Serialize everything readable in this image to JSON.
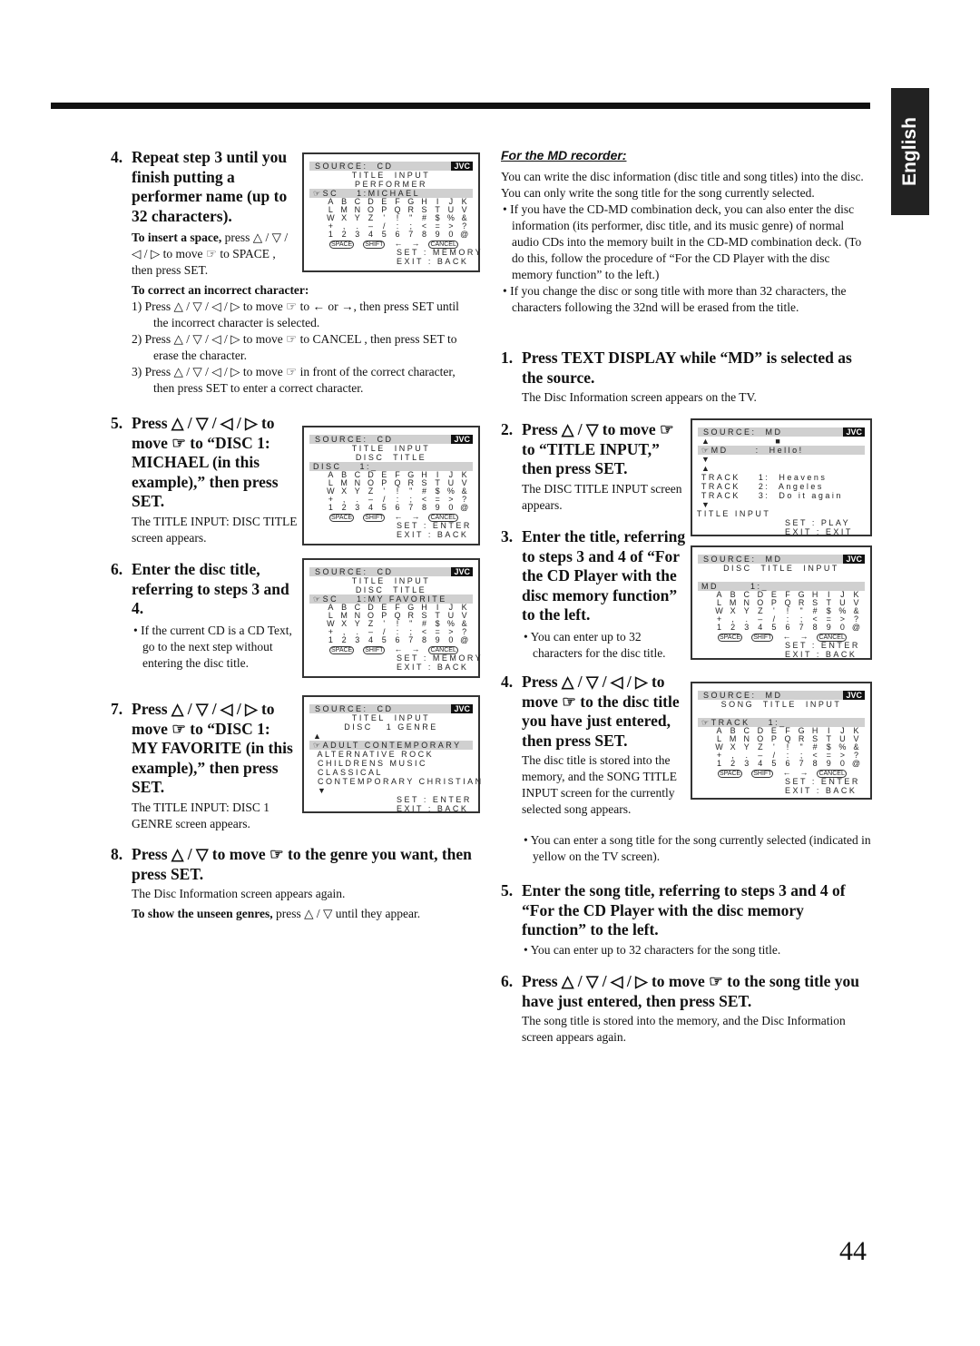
{
  "tab_label": "English",
  "page_number": "44",
  "left": {
    "step4": {
      "num": "4.",
      "title": "Repeat step 3 until you finish putting a performer name (up to 32 characters).",
      "insert_bold": "To insert a space,",
      "insert_text": " press △ / ▽ / ◁ / ▷ to move ☞ to SPACE , then press SET.",
      "correct_heading": "To correct an incorrect character:",
      "correct_items": [
        "1)  Press △ / ▽ / ◁ / ▷ to move ☞ to ← or →, then press SET until the incorrect character is selected.",
        "2)  Press △ / ▽ / ◁ / ▷ to move ☞ to CANCEL , then press SET to erase the character.",
        "3)  Press △ / ▽ / ◁ / ▷ to move ☞ in front of the correct character, then press SET to enter a correct character."
      ]
    },
    "step5": {
      "num": "5.",
      "title": "Press △ / ▽ / ◁ / ▷ to move ☞ to “DISC 1: MICHAEL (in this example),” then press SET.",
      "text": "The TITLE INPUT: DISC TITLE screen appears."
    },
    "step6": {
      "num": "6.",
      "title": "Enter the disc title, referring to steps 3 and 4.",
      "bullet": "If the current CD is a CD Text, go to the next step without entering the disc title."
    },
    "step7": {
      "num": "7.",
      "title": "Press △ / ▽ / ◁ / ▷ to move ☞ to “DISC 1: MY FAVORITE (in this example),” then press SET.",
      "text": "The TITLE INPUT: DISC 1 GENRE screen appears."
    },
    "step8": {
      "num": "8.",
      "title": "Press △ / ▽ to move ☞ to the genre you want, then press SET.",
      "text": "The Disc Information screen appears again.",
      "unseen_bold": "To show the unseen genres,",
      "unseen_text": " press △ / ▽ until they appear."
    }
  },
  "right": {
    "heading": "For the MD recorder:",
    "intro": "You can write the disc information (disc title and song titles) into the disc. You can only write the song title for the song currently selected.",
    "bullets": [
      "If you have the CD-MD combination deck, you can also enter the disc information (its performer, disc title, and its music genre) of normal audio CDs into the memory built in the CD-MD combination deck. (To do this, follow the procedure of “For the CD Player with the disc memory function” to the left.)",
      "If you change the disc or song title with more than 32 characters, the characters following the 32nd will be erased from the title."
    ],
    "step1": {
      "num": "1.",
      "title": "Press TEXT DISPLAY while “MD” is selected as the source.",
      "text": "The Disc Information screen appears on the TV."
    },
    "step2": {
      "num": "2.",
      "title": "Press △ / ▽ to move ☞ to “TITLE INPUT,” then press SET.",
      "text": "The DISC TITLE INPUT screen appears."
    },
    "step3": {
      "num": "3.",
      "title": "Enter the title, referring to steps 3 and 4 of “For the CD Player with the disc memory function” to the left.",
      "bullet": "You can enter up to 32 characters for the disc title."
    },
    "step4": {
      "num": "4.",
      "title": "Press △ / ▽ / ◁ / ▷ to move ☞ to the disc title you have just entered, then press SET.",
      "text": "The disc title is stored into the memory, and the SONG TITLE INPUT screen for the currently selected song appears.",
      "bullet": "You can enter a song title for the song currently selected (indicated in yellow on the TV screen)."
    },
    "step5": {
      "num": "5.",
      "title": "Enter the song title, referring to steps 3 and 4 of “For the CD Player with the disc memory function” to the left.",
      "bullet": "You can enter up to 32 characters for the song title."
    },
    "step6": {
      "num": "6.",
      "title": "Press △ / ▽ / ◁ / ▷ to move ☞ to the song title you have just entered, then press SET.",
      "text": "The song title is stored into the memory, and the Disc Information screen appears again."
    }
  },
  "keyboard": [
    "A",
    "B",
    "C",
    "D",
    "E",
    "F",
    "G",
    "H",
    "I",
    "J",
    "K",
    "L",
    "M",
    "N",
    "O",
    "P",
    "Q",
    "R",
    "S",
    "T",
    "U",
    "V",
    "W",
    "X",
    "Y",
    "Z",
    "'",
    "!",
    "\"",
    "#",
    "$",
    "%",
    "&",
    "+",
    ",",
    ".",
    "–",
    "/",
    ":",
    ";",
    "<",
    "=",
    ">",
    "?",
    "1",
    "2",
    "3",
    "4",
    "5",
    "6",
    "7",
    "8",
    "9",
    "0",
    "@"
  ],
  "keyboard_keys": {
    "space": "SPACE",
    "shift": "SHIFT",
    "left": "←",
    "right": "→",
    "cancel": "CANCEL"
  },
  "brand": "JVC",
  "screens": [
    {
      "id": "performer",
      "source": "SOURCE:  CD",
      "lines": [
        {
          "t": "TITLE  INPUT",
          "c": 1,
          "mk": 1
        },
        {
          "t": "PERFORMER",
          "c": 1
        },
        {
          "t": "☞SC    1:MICHAEL",
          "hl": 1
        }
      ],
      "kb": 1,
      "footer": [
        "SET : MEMORY",
        "EXIT : BACK"
      ]
    },
    {
      "id": "disc-title",
      "source": "SOURCE:  CD",
      "lines": [
        {
          "t": "TITLE  INPUT",
          "c": 1,
          "mk": 1
        },
        {
          "t": "DISC  TITLE",
          "c": 1
        },
        {
          "t": "DISC    1:_",
          "hl": 1
        }
      ],
      "kb": 1,
      "footer": [
        "SET : ENTER",
        "EXIT : BACK"
      ]
    },
    {
      "id": "disc-title-favorite",
      "source": "SOURCE:  CD",
      "lines": [
        {
          "t": "TITLE  INPUT",
          "c": 1,
          "mk": 1
        },
        {
          "t": "DISC  TITLE",
          "c": 1
        },
        {
          "t": "☞SC    1:MY FAVORITE",
          "hl": 1
        }
      ],
      "kb": 1,
      "footer": [
        "SET : MEMORY",
        "EXIT : BACK"
      ]
    },
    {
      "id": "genre",
      "source": "SOURCE:  CD",
      "lines": [
        {
          "t": "TITEL  INPUT",
          "c": 1,
          "mk": 1
        },
        {
          "t": "DISC   1 GENRE",
          "c": 1
        },
        {
          "t": "  ▲"
        },
        {
          "t": "☞ADULT CONTEMPORARY",
          "hl": 1
        },
        {
          "t": "   ALTERNATIVE ROCK"
        },
        {
          "t": "   CHILDRENS MUSIC"
        },
        {
          "t": "   CLASSICAL"
        },
        {
          "t": "   CONTEMPORARY CHRISTIAN"
        },
        {
          "t": "   ▼"
        }
      ],
      "kb": 0,
      "footer": [
        "SET : ENTER",
        "EXIT : BACK"
      ]
    },
    {
      "id": "md-info",
      "source": "SOURCE:  MD",
      "lines": [
        {
          "t": "  ▲              ■"
        },
        {
          "t": "☞MD      :  Hello!",
          "hl": 1
        },
        {
          "t": "  ▼"
        },
        {
          "t": "  ▲"
        },
        {
          "t": "  TRACK    1:  Heavens"
        },
        {
          "t": "  TRACK    2:  Angeles"
        },
        {
          "t": "  TRACK    3:  Do it again"
        },
        {
          "t": "  ▼"
        },
        {
          "t": " TITLE INPUT"
        }
      ],
      "kb": 0,
      "footer": [
        "SET : PLAY",
        "EXIT : EXIT"
      ]
    },
    {
      "id": "md-disc-title",
      "source": "SOURCE:  MD",
      "lines": [
        {
          "t": "DISC  TITLE  INPUT",
          "c": 1,
          "mk": 1
        },
        {
          "t": ""
        },
        {
          "t": "MD       1:_",
          "hl": 1
        }
      ],
      "kb": 1,
      "footer": [
        "SET : ENTER",
        "EXIT : BACK"
      ]
    },
    {
      "id": "md-song-title",
      "source": "SOURCE:  MD",
      "lines": [
        {
          "t": "SONG  TITLE  INPUT",
          "c": 1,
          "mk": 1
        },
        {
          "t": ""
        },
        {
          "t": "☞TRACK    1:_",
          "hl": 1
        }
      ],
      "kb": 1,
      "footer": [
        "SET : ENTER",
        "EXIT : BACK"
      ]
    }
  ]
}
